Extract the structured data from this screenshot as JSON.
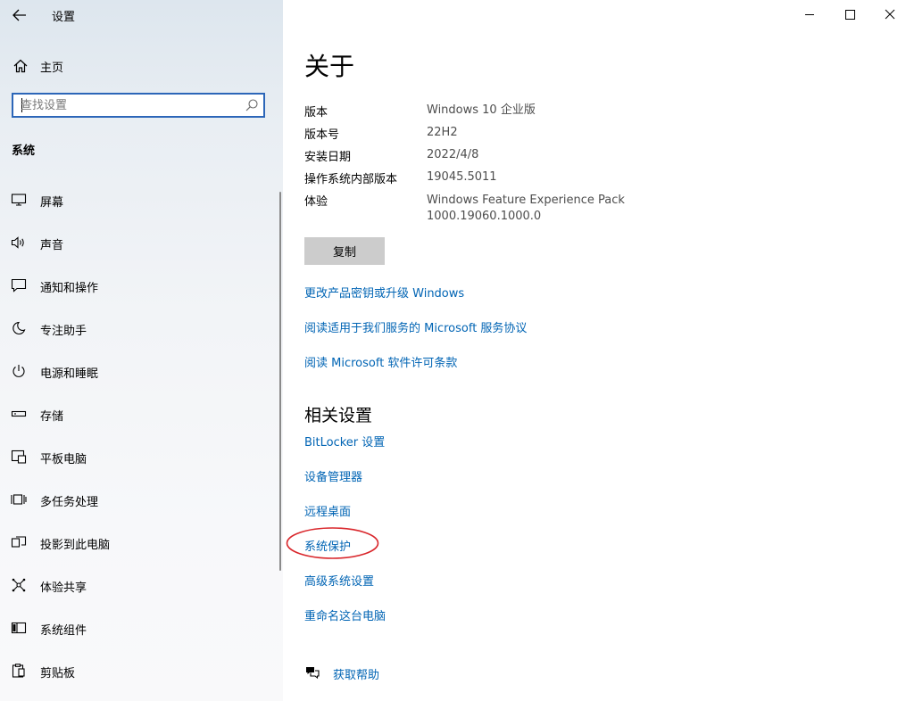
{
  "window": {
    "title": "设置"
  },
  "sidebar": {
    "home_label": "主页",
    "search": {
      "placeholder": "查找设置"
    },
    "section_title": "系统",
    "items": [
      {
        "label": "屏幕",
        "icon": "monitor-icon"
      },
      {
        "label": "声音",
        "icon": "speaker-icon"
      },
      {
        "label": "通知和操作",
        "icon": "notification-icon"
      },
      {
        "label": "专注助手",
        "icon": "moon-icon"
      },
      {
        "label": "电源和睡眠",
        "icon": "power-icon"
      },
      {
        "label": "存储",
        "icon": "storage-icon"
      },
      {
        "label": "平板电脑",
        "icon": "tablet-icon"
      },
      {
        "label": "多任务处理",
        "icon": "multitask-icon"
      },
      {
        "label": "投影到此电脑",
        "icon": "project-icon"
      },
      {
        "label": "体验共享",
        "icon": "share-icon"
      },
      {
        "label": "系统组件",
        "icon": "components-icon"
      },
      {
        "label": "剪贴板",
        "icon": "clipboard-icon"
      }
    ]
  },
  "main": {
    "title": "关于",
    "specs": [
      {
        "key": "版本",
        "value": "Windows 10 企业版"
      },
      {
        "key": "版本号",
        "value": "22H2"
      },
      {
        "key": "安装日期",
        "value": "2022/4/8"
      },
      {
        "key": "操作系统内部版本",
        "value": "19045.5011"
      },
      {
        "key": "体验",
        "value": "Windows Feature Experience Pack",
        "value2": "1000.19060.1000.0"
      }
    ],
    "copy_label": "复制",
    "links": [
      "更改产品密钥或升级 Windows",
      "阅读适用于我们服务的 Microsoft 服务协议",
      "阅读 Microsoft 软件许可条款"
    ],
    "related_title": "相关设置",
    "related_links": [
      "BitLocker 设置",
      "设备管理器",
      "远程桌面",
      "系统保护",
      "高级系统设置",
      "重命名这台电脑"
    ],
    "help_label": "获取帮助"
  },
  "colors": {
    "accent": "#0064b4",
    "search_border": "#2c66b8",
    "annotation": "#d9262b"
  }
}
